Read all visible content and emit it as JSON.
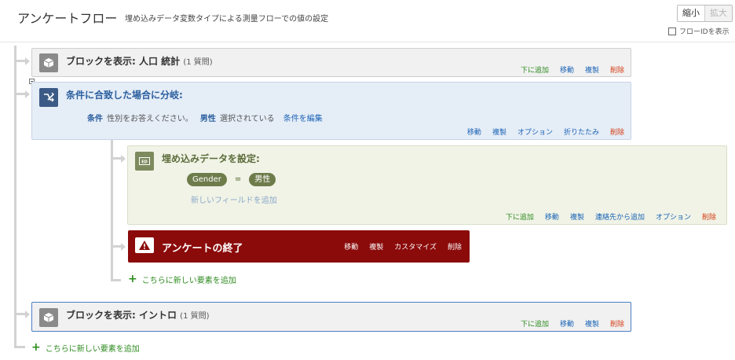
{
  "header": {
    "title": "アンケートフロー",
    "subtitle": "埋め込みデータ変数タイプによる測量フローでの値の設定",
    "zoom_out": "縮小",
    "zoom_in": "拡大",
    "flow_id_label": "フローIDを表示"
  },
  "block1": {
    "title": "ブロックを表示: 人口 統計",
    "count": "(1 質問)",
    "actions": {
      "add_below": "下に追加",
      "move": "移動",
      "copy": "複製",
      "delete": "削除"
    }
  },
  "branch": {
    "title": "条件に合致した場合に分岐:",
    "cond_label": "条件",
    "cond_question": "性別をお答えください。",
    "cond_value": "男性",
    "cond_operator": "選択されている",
    "edit_condition": "条件を編集",
    "actions": {
      "move": "移動",
      "copy": "複製",
      "options": "オプション",
      "collapse": "折りたたみ",
      "delete": "削除"
    }
  },
  "embedded": {
    "title": "埋め込みデータを設定:",
    "field_name": "Gender",
    "equals": "=",
    "field_value": "男性",
    "add_field": "新しいフィールドを追加",
    "actions": {
      "add_below": "下に追加",
      "move": "移動",
      "copy": "複製",
      "add_from_contacts": "連絡先から追加",
      "options": "オプション",
      "delete": "削除"
    }
  },
  "end_survey": {
    "title": "アンケートの終了",
    "actions": {
      "move": "移動",
      "copy": "複製",
      "customize": "カスタマイズ",
      "delete": "削除"
    }
  },
  "add_inner": "こちらに新しい要素を追加",
  "block2": {
    "title": "ブロックを表示: イントロ",
    "count": "(1 質問)",
    "actions": {
      "add_below": "下に追加",
      "move": "移動",
      "copy": "複製",
      "delete": "削除"
    }
  },
  "add_outer": "こちらに新しい要素を追加",
  "colors": {
    "branch_bg": "#e5edf7",
    "embedded_bg": "#f0f3e6",
    "end_survey_bg": "#8b0a0a",
    "add_green": "#2e8b1f",
    "delete_red": "#d43b12",
    "link_blue": "#1a63b6"
  }
}
